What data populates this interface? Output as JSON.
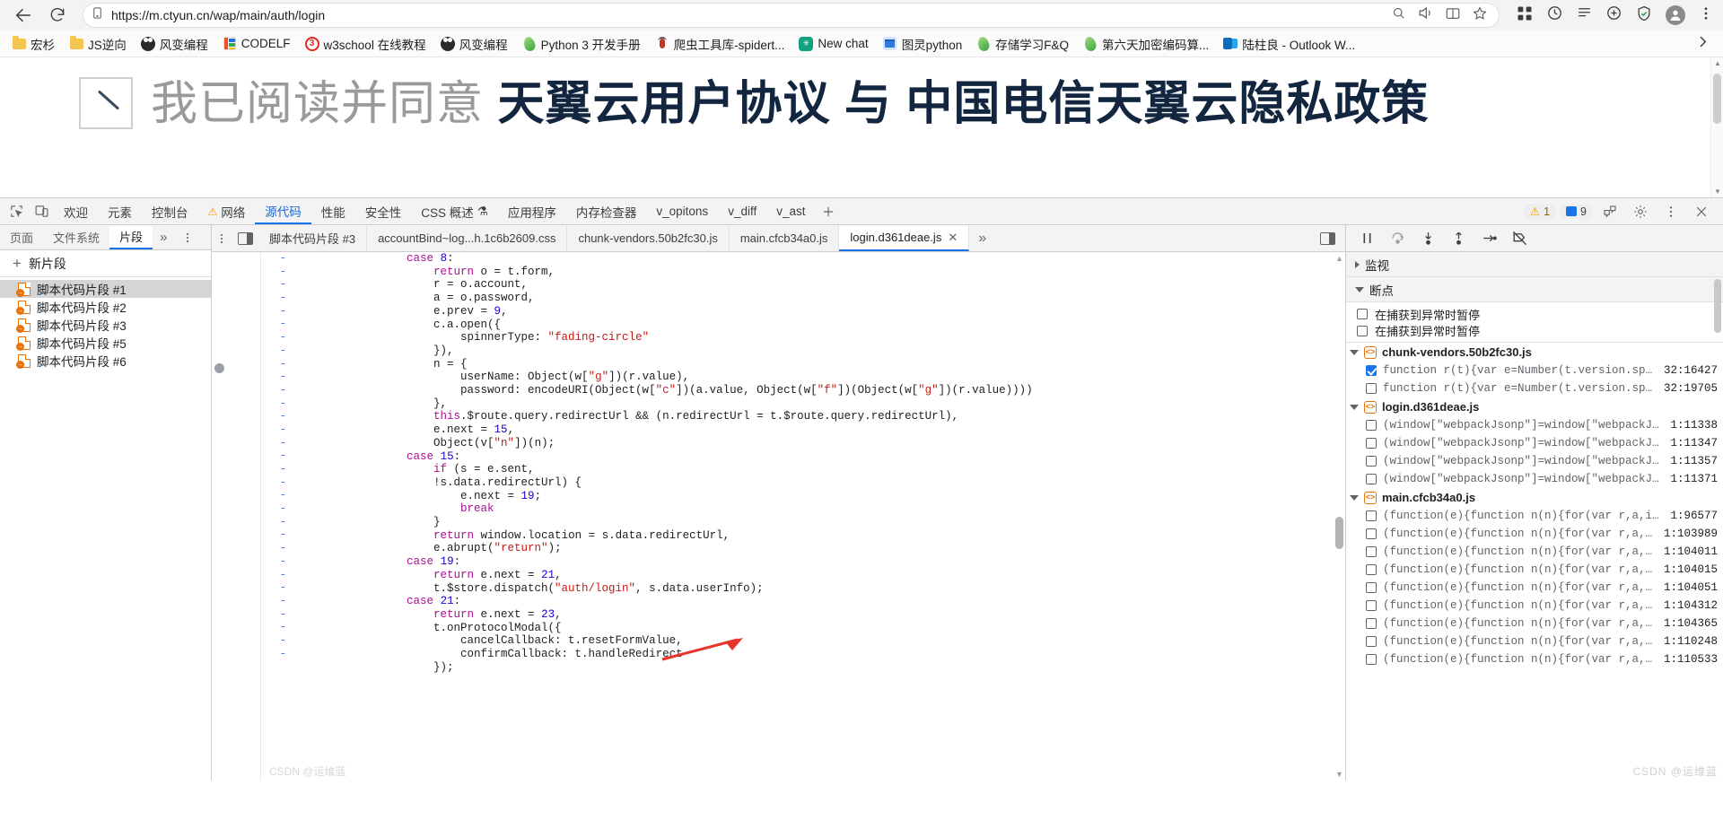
{
  "browser": {
    "url": "https://m.ctyun.cn/wap/main/auth/login",
    "back_icon": "back-arrow-icon",
    "reload_icon": "reload-icon",
    "site_info_icon": "page-info-icon",
    "bookmarks": [
      {
        "label": "宏杉",
        "icon": "folder-icon"
      },
      {
        "label": "JS逆向",
        "icon": "folder-icon"
      },
      {
        "label": "风变编程",
        "icon": "panda-favicon"
      },
      {
        "label": "CODELF",
        "icon": "codelf-favicon"
      },
      {
        "label": "w3school 在线教程",
        "icon": "w3school-favicon"
      },
      {
        "label": "风变编程",
        "icon": "panda-favicon"
      },
      {
        "label": "Python 3 开发手册",
        "icon": "python-favicon"
      },
      {
        "label": "爬虫工具库-spidert...",
        "icon": "bug-favicon"
      },
      {
        "label": "New chat",
        "icon": "chatgpt-favicon"
      },
      {
        "label": "图灵python",
        "icon": "turing-favicon"
      },
      {
        "label": "存储学习F&Q",
        "icon": "python-favicon"
      },
      {
        "label": "第六天加密编码算...",
        "icon": "python-favicon"
      },
      {
        "label": "陆柱良 - Outlook W...",
        "icon": "outlook-favicon"
      }
    ],
    "bookmarks_overflow_icon": "chevron-right-icon"
  },
  "viewport": {
    "consent_text_gray": "我已阅读并同意",
    "consent_text_dark": "天翼云用户协议 与 中国电信天翼云隐私政策",
    "checkbox_icon": "checkbox-checked-icon"
  },
  "devtools": {
    "inspect_icon": "inspect-element-icon",
    "device_icon": "toggle-device-toolbar-icon",
    "tabs": [
      {
        "label": "欢迎",
        "active": false
      },
      {
        "label": "元素",
        "active": false
      },
      {
        "label": "控制台",
        "active": false
      },
      {
        "label": "网络",
        "active": false,
        "warning": true
      },
      {
        "label": "源代码",
        "active": true
      },
      {
        "label": "性能",
        "active": false
      },
      {
        "label": "安全性",
        "active": false
      },
      {
        "label": "CSS 概述",
        "active": false,
        "beaker": true
      },
      {
        "label": "应用程序",
        "active": false
      },
      {
        "label": "内存检查器",
        "active": false
      },
      {
        "label": "v_opitons",
        "active": false
      },
      {
        "label": "v_diff",
        "active": false
      },
      {
        "label": "v_ast",
        "active": false
      }
    ],
    "add_tab_icon": "plus-icon",
    "warnings_count": "1",
    "messages_count": "9",
    "warning_icon": "warning-triangle-icon",
    "message_icon": "message-icon",
    "feedback_icon": "feedback-icon",
    "settings_icon": "gear-icon",
    "more_icon": "kebab-menu-icon",
    "close_icon": "close-icon"
  },
  "navigator": {
    "tabs": [
      {
        "label": "页面",
        "active": false
      },
      {
        "label": "文件系统",
        "active": false
      },
      {
        "label": "片段",
        "active": true
      }
    ],
    "more_icon": "chevron-double-right-icon",
    "kebab_icon": "kebab-menu-icon",
    "new_snippet_label": "新片段",
    "snippets": [
      {
        "label": "脚本代码片段 #1",
        "selected": true
      },
      {
        "label": "脚本代码片段 #2",
        "selected": false
      },
      {
        "label": "脚本代码片段 #3",
        "selected": false
      },
      {
        "label": "脚本代码片段 #5",
        "selected": false
      },
      {
        "label": "脚本代码片段 #6",
        "selected": false
      }
    ]
  },
  "editor": {
    "file_tabs": [
      {
        "label": "脚本代码片段 #3",
        "active": false
      },
      {
        "label": "accountBind~log...h.1c6b2609.css",
        "active": false
      },
      {
        "label": "chunk-vendors.50b2fc30.js",
        "active": false
      },
      {
        "label": "main.cfcb34a0.js",
        "active": false
      },
      {
        "label": "login.d361deae.js",
        "active": true
      }
    ],
    "more_tabs_icon": "chevron-double-right-icon",
    "show_navigator_icon": "show-navigator-icon",
    "kebab_icon": "kebab-menu-icon",
    "line_marker": "-",
    "code_lines": [
      "                case 8:",
      "                    return o = t.form,",
      "                    r = o.account,",
      "                    a = o.password,",
      "                    e.prev = 9,",
      "                    c.a.open({",
      "                        spinnerType: \"fading-circle\"",
      "                    }),",
      "                    n = {",
      "                        userName: Object(w[\"g\"])(r.value),",
      "                        password: encodeURI(Object(w[\"c\"])(a.value, Object(w[\"f\"])(Object(w[\"g\"])(r.value))))",
      "                    },",
      "                    this.$route.query.redirectUrl && (n.redirectUrl = t.$route.query.redirectUrl),",
      "                    e.next = 15,",
      "                    Object(v[\"n\"])(n);",
      "                case 15:",
      "                    if (s = e.sent,",
      "                    !s.data.redirectUrl) {",
      "                        e.next = 19;",
      "                        break",
      "                    }",
      "                    return window.location = s.data.redirectUrl,",
      "                    e.abrupt(\"return\");",
      "                case 19:",
      "                    return e.next = 21,",
      "                    t.$store.dispatch(\"auth/login\", s.data.userInfo);",
      "                case 21:",
      "                    return e.next = 23,",
      "                    t.onProtocolModal({",
      "                        cancelCallback: t.resetFormValue,",
      "                        confirmCallback: t.handleRedirect",
      "                    });"
    ],
    "annotation_arrow": "red-arrow-annotation"
  },
  "debugger": {
    "toolbar_icons": [
      "resume-script-icon",
      "step-over-icon",
      "step-into-icon",
      "step-out-icon",
      "step-icon",
      "deactivate-breakpoints-icon"
    ],
    "watch": {
      "label": "监视",
      "expanded": false
    },
    "breakpoints": {
      "label": "断点",
      "expanded": true
    },
    "pause_options": [
      {
        "label": "在捕获到异常时暂停",
        "checked": false
      },
      {
        "label": "在捕获到异常时暂停",
        "checked": false
      }
    ],
    "groups": [
      {
        "file": "chunk-vendors.50b2fc30.js",
        "items": [
          {
            "code": "function r(t){var e=Number(t.version.split…",
            "loc": "32:16427",
            "checked": true
          },
          {
            "code": "function r(t){var e=Number(t.version.split…",
            "loc": "32:19705",
            "checked": false
          }
        ]
      },
      {
        "file": "login.d361deae.js",
        "items": [
          {
            "code": "(window[\"webpackJsonp\"]=window[\"webpackJson…",
            "loc": "1:11338",
            "checked": false
          },
          {
            "code": "(window[\"webpackJsonp\"]=window[\"webpackJson…",
            "loc": "1:11347",
            "checked": false
          },
          {
            "code": "(window[\"webpackJsonp\"]=window[\"webpackJson…",
            "loc": "1:11357",
            "checked": false
          },
          {
            "code": "(window[\"webpackJsonp\"]=window[\"webpackJson…",
            "loc": "1:11371",
            "checked": false
          }
        ]
      },
      {
        "file": "main.cfcb34a0.js",
        "items": [
          {
            "code": "(function(e){function n(n){for(var r,a,i=n[…",
            "loc": "1:96577",
            "checked": false
          },
          {
            "code": "(function(e){function n(n){for(var r,a,i=n…",
            "loc": "1:103989",
            "checked": false
          },
          {
            "code": "(function(e){function n(n){for(var r,a,i=n…",
            "loc": "1:104011",
            "checked": false
          },
          {
            "code": "(function(e){function n(n){for(var r,a,i=n…",
            "loc": "1:104015",
            "checked": false
          },
          {
            "code": "(function(e){function n(n){for(var r,a,i=n…",
            "loc": "1:104051",
            "checked": false
          },
          {
            "code": "(function(e){function n(n){for(var r,a,i=n…",
            "loc": "1:104312",
            "checked": false
          },
          {
            "code": "(function(e){function n(n){for(var r,a,i=n…",
            "loc": "1:104365",
            "checked": false
          },
          {
            "code": "(function(e){function n(n){for(var r,a,i=n…",
            "loc": "1:110248",
            "checked": false
          },
          {
            "code": "(function(e){function n(n){for(var r,a,i=n…",
            "loc": "1:110533",
            "checked": false
          }
        ]
      }
    ]
  },
  "watermark": "CSDN @运维蓝",
  "colors": {
    "accent": "#1a73e8",
    "warning": "#f29900",
    "snippet_orange": "#e8710a",
    "string_red": "#c41a16",
    "number_blue": "#1c00cf",
    "keyword_purple": "#aa0d91"
  }
}
